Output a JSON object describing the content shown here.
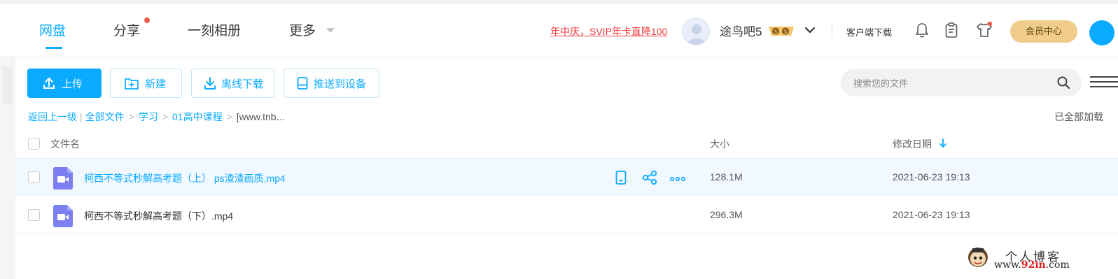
{
  "nav": {
    "items": [
      {
        "label": "网盘",
        "active": true
      },
      {
        "label": "分享",
        "dot": true
      },
      {
        "label": "一刻相册"
      },
      {
        "label": "更多",
        "caret": true
      }
    ]
  },
  "header": {
    "promo": "年中庆，SVIP年卡直降100",
    "username": "途鸟吧5",
    "client_download": "客户端下载",
    "vip_center": "会员中心",
    "icons": [
      "bell-icon",
      "clipboard-icon",
      "shirt-icon"
    ]
  },
  "toolbar": {
    "upload": "上传",
    "new": "新建",
    "offline": "离线下载",
    "push": "推送到设备"
  },
  "search": {
    "placeholder": "搜索您的文件"
  },
  "breadcrumb": {
    "back": "返回上一级",
    "all": "全部文件",
    "items": [
      "学习",
      "01高中课程",
      "[www.tnb..."
    ],
    "loaded_status": "已全部加载"
  },
  "table": {
    "headers": {
      "name": "文件名",
      "size": "大小",
      "date": "修改日期"
    },
    "rows": [
      {
        "name": "柯西不等式秒解高考题（上） ps渣渣画质.mp4",
        "size": "128.1M",
        "date": "2021-06-23 19:13"
      },
      {
        "name": "柯西不等式秒解高考题（下）.mp4",
        "size": "296.3M",
        "date": "2021-06-23 19:13"
      }
    ]
  },
  "watermark": {
    "title": "个人博客",
    "url_prefix": "www.",
    "url_brand": "92in",
    "url_suffix": ".com"
  },
  "colors": {
    "accent": "#09aaff",
    "promo": "#f23c3c",
    "vip": "#f1cd8b",
    "video_icon": "#7c7ff0"
  }
}
